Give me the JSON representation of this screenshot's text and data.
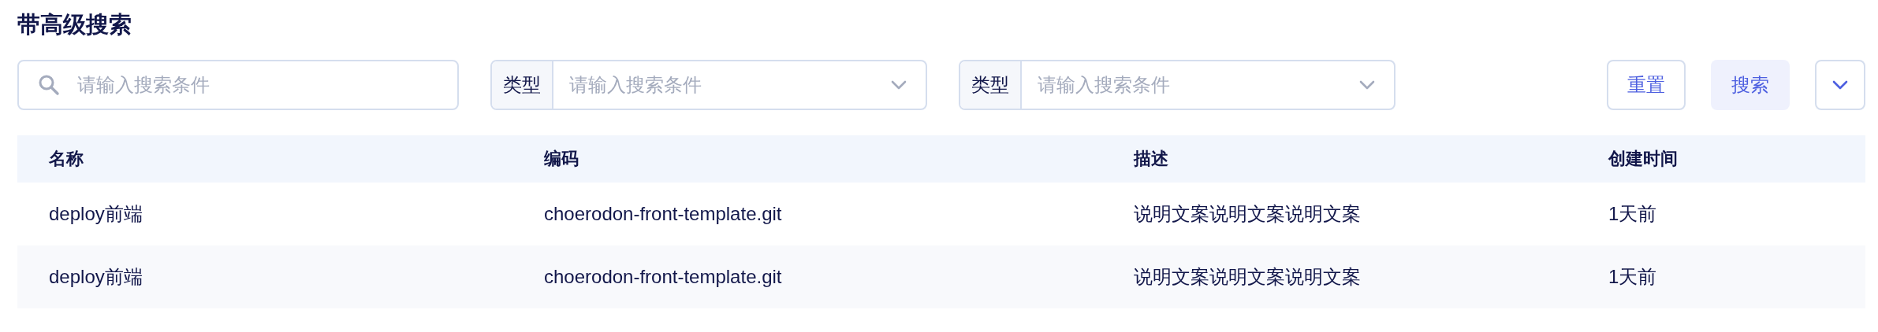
{
  "title": "带高级搜索",
  "search": {
    "placeholder": "请输入搜索条件"
  },
  "filters": [
    {
      "label": "类型",
      "placeholder": "请输入搜索条件"
    },
    {
      "label": "类型",
      "placeholder": "请输入搜索条件"
    }
  ],
  "buttons": [
    {
      "label": "重置",
      "kind": "outline"
    },
    {
      "label": "搜索",
      "kind": "soft"
    }
  ],
  "table": {
    "columns": [
      "名称",
      "编码",
      "描述",
      "创建时间"
    ],
    "rows": [
      [
        "deploy前端",
        "choerodon-front-template.git",
        "说明文案说明文案说明文案",
        "1天前"
      ],
      [
        "deploy前端",
        "choerodon-front-template.git",
        "说明文案说明文案说明文案",
        "1天前"
      ]
    ]
  }
}
